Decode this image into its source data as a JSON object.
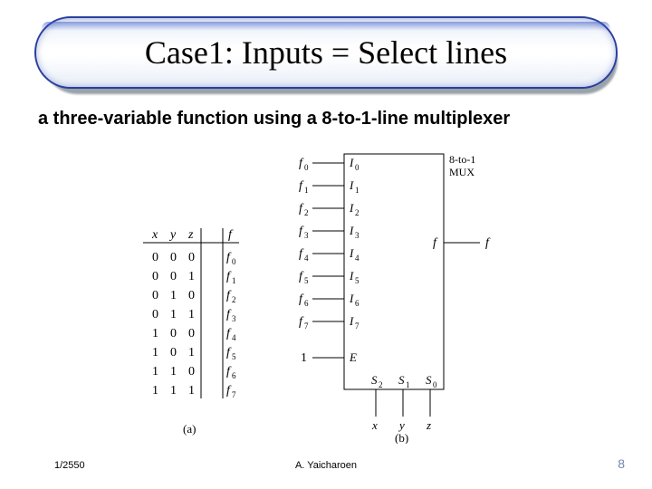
{
  "title": "Case1: Inputs = Select lines",
  "subtitle": "a three-variable function using a 8-to-1-line multiplexer",
  "mux_label": "8-to-1\nMUX",
  "truth_table": {
    "headers": [
      "x",
      "y",
      "z",
      "f"
    ],
    "rows": [
      {
        "x": "0",
        "y": "0",
        "z": "0",
        "f": "f",
        "fi": "0"
      },
      {
        "x": "0",
        "y": "0",
        "z": "1",
        "f": "f",
        "fi": "1"
      },
      {
        "x": "0",
        "y": "1",
        "z": "0",
        "f": "f",
        "fi": "2"
      },
      {
        "x": "0",
        "y": "1",
        "z": "1",
        "f": "f",
        "fi": "3"
      },
      {
        "x": "1",
        "y": "0",
        "z": "0",
        "f": "f",
        "fi": "4"
      },
      {
        "x": "1",
        "y": "0",
        "z": "1",
        "f": "f",
        "fi": "5"
      },
      {
        "x": "1",
        "y": "1",
        "z": "0",
        "f": "f",
        "fi": "6"
      },
      {
        "x": "1",
        "y": "1",
        "z": "1",
        "f": "f",
        "fi": "7"
      }
    ]
  },
  "mux_inputs": [
    {
      "label": "f",
      "sub": "0",
      "pin": "I",
      "pinsub": "0"
    },
    {
      "label": "f",
      "sub": "1",
      "pin": "I",
      "pinsub": "1"
    },
    {
      "label": "f",
      "sub": "2",
      "pin": "I",
      "pinsub": "2"
    },
    {
      "label": "f",
      "sub": "3",
      "pin": "I",
      "pinsub": "3"
    },
    {
      "label": "f",
      "sub": "4",
      "pin": "I",
      "pinsub": "4"
    },
    {
      "label": "f",
      "sub": "5",
      "pin": "I",
      "pinsub": "5"
    },
    {
      "label": "f",
      "sub": "6",
      "pin": "I",
      "pinsub": "6"
    },
    {
      "label": "f",
      "sub": "7",
      "pin": "I",
      "pinsub": "7"
    }
  ],
  "enable_label": "1",
  "enable_pin": "E",
  "selects": [
    {
      "pin": "S",
      "sub": "2",
      "var": "x"
    },
    {
      "pin": "S",
      "sub": "1",
      "var": "y"
    },
    {
      "pin": "S",
      "sub": "0",
      "var": "z"
    }
  ],
  "output_pin": "f",
  "output_var": "f",
  "fig_labels": {
    "a": "(a)",
    "b": "(b)"
  },
  "footer": {
    "left": "1/2550",
    "center": "A. Yaicharoen",
    "right": "8"
  }
}
